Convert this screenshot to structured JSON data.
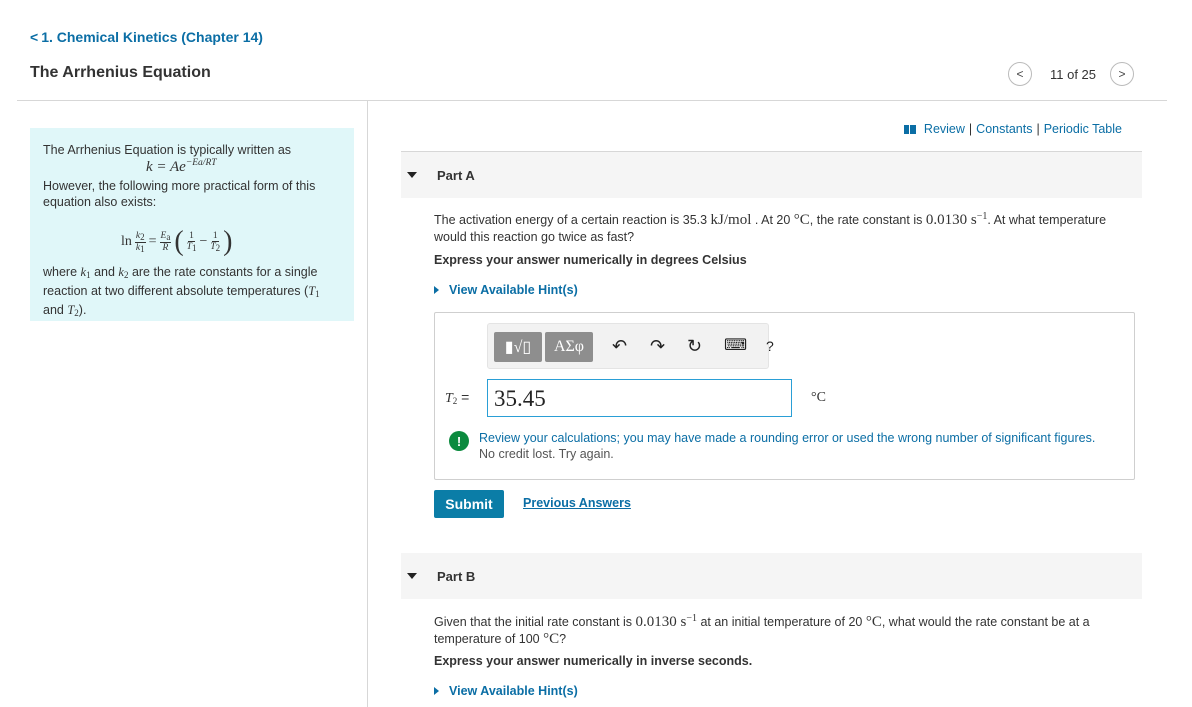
{
  "breadcrumb": {
    "chevron": "<",
    "label": "1. Chemical Kinetics (Chapter 14)"
  },
  "title": "The Arrhenius Equation",
  "pager": {
    "prev": "<",
    "count": "11 of 25",
    "next": ">"
  },
  "intro": {
    "line1": "The Arrhenius Equation is typically written as",
    "formula1": "k = Ae",
    "formula1_exp": "−Ea/RT",
    "line2": "However, the following more practical form of this equation also exists:",
    "formula2": {
      "ln": "ln",
      "k2": "k",
      "k1": "k",
      "eq": "=",
      "Ea": "E",
      "R": "R",
      "one": "1",
      "T1": "T",
      "minus": "−",
      "T2": "T"
    },
    "line3a": "where ",
    "k1": "k",
    "and": " and ",
    "k2": "k",
    "line3b": " are the rate constants for a single reaction at two different absolute temperatures (",
    "T1": "T",
    "and2": " and ",
    "T2": "T",
    "end": ")."
  },
  "links": {
    "review": "Review",
    "constants": "Constants",
    "periodic": "Periodic Table",
    "sep": "|"
  },
  "partA": {
    "label": "Part A",
    "q1": "The activation energy of a certain reaction is 35.3 ",
    "q_unit1": "kJ/mol",
    "q2": " . At 20 ",
    "q_deg": "°C",
    "q3": ", the rate constant is ",
    "q_val": "0.0130 s",
    "q_exp": "−1",
    "q4": ". At what temperature would this reaction go twice as fast?",
    "express": "Express your answer numerically in degrees Celsius",
    "hint": "View Available Hint(s)",
    "toolbar": {
      "templates": "▮√▯",
      "greek": "ΑΣφ",
      "undo": "↶",
      "redo": "↷",
      "reset": "↻",
      "keyboard": "⌨",
      "help": "?"
    },
    "input_label": "T",
    "input_label_sub": "2",
    "input_eq": " =",
    "input_value": "35.45",
    "unit": "°C",
    "feedback_main": "Review your calculations; you may have made a rounding error or used the wrong number of significant figures.",
    "feedback_sub": "No credit lost. Try again.",
    "submit": "Submit",
    "previous": "Previous Answers"
  },
  "partB": {
    "label": "Part B",
    "q1": "Given that the initial rate constant is ",
    "q_val": "0.0130 s",
    "q_exp": "−1",
    "q2": " at an initial temperature of 20 ",
    "q_deg": "°C",
    "q3": ", what would the rate constant be at a temperature of 100 ",
    "q_deg2": "°C",
    "q4": "?",
    "express": "Express your answer numerically in inverse seconds.",
    "hint": "View Available Hint(s)"
  }
}
